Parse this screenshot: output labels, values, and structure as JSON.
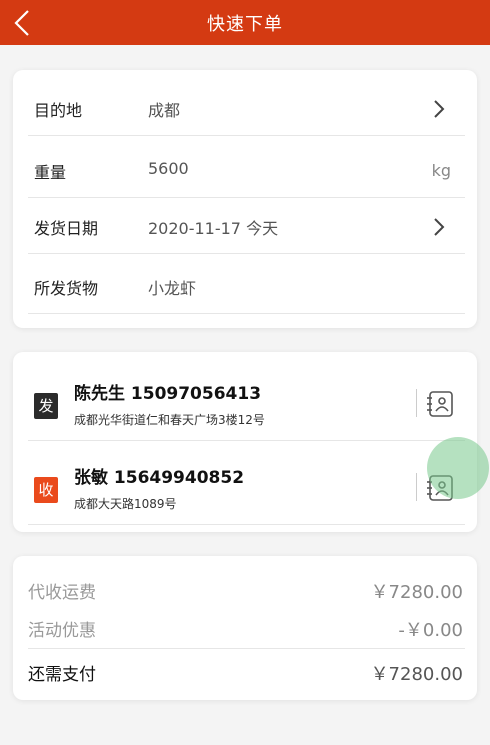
{
  "header": {
    "title": "快速下单"
  },
  "order": {
    "destination": {
      "label": "目的地",
      "value": "成都"
    },
    "weight": {
      "label": "重量",
      "value": "5600",
      "unit": "kg"
    },
    "ship_date": {
      "label": "发货日期",
      "value": "2020-11-17 今天"
    },
    "goods": {
      "label": "所发货物",
      "value": "小龙虾"
    }
  },
  "contacts": {
    "sender": {
      "badge": "发",
      "name": "陈先生 15097056413",
      "address": "成都光华街道仁和春天广场3楼12号"
    },
    "receiver": {
      "badge": "收",
      "name": "张敏 15649940852",
      "address": "成都大天路1089号"
    }
  },
  "fees": {
    "collect_freight": {
      "label": "代收运费",
      "value": "￥7280.00"
    },
    "discount": {
      "label": "活动优惠",
      "value": "-￥0.00"
    },
    "due": {
      "label": "还需支付",
      "value": "￥7280.00"
    }
  },
  "icons": {
    "back": "chevron-left-icon",
    "contact_book": "address-book-icon",
    "arrow": "chevron-right-icon"
  },
  "colors": {
    "brand": "#d43a12",
    "receive_badge": "#ea4a1c",
    "send_badge": "#2b2b2b"
  }
}
